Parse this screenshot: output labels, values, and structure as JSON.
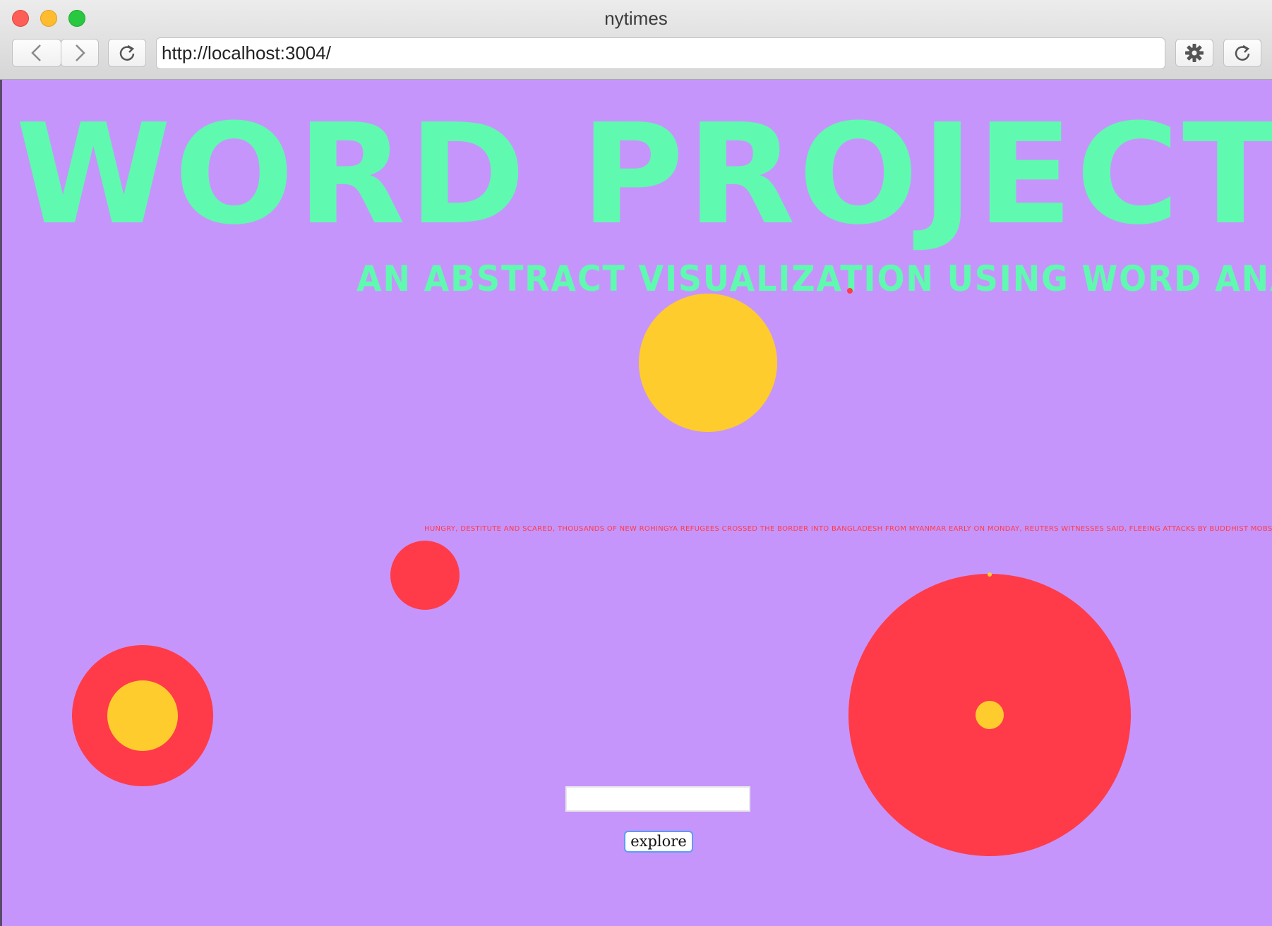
{
  "browser": {
    "window_title": "nytimes",
    "url": "http://localhost:3004/",
    "icons": [
      "back-arrow-icon",
      "forward-arrow-icon",
      "reload-icon",
      "gear-icon",
      "refresh-icon"
    ]
  },
  "page": {
    "headline": "WORD PROJECT",
    "subtitle": "AN ABSTRACT VISUALIZATION USING WORD ANALYZATION",
    "ticker_text": "HUNGRY, DESTITUTE AND SCARED, THOUSANDS OF NEW ROHINGYA REFUGEES CROSSED THE BORDER INTO BANGLADESH FROM MYANMAR EARLY ON MONDAY, REUTERS WITNESSES SAID, FLEEING ATTACKS BY BUDDHIST MOBS AND HUNGER THAT THE UNITED NATIONS HA",
    "search_value": "",
    "explore_label": "explore"
  },
  "colors": {
    "background": "#c695fb",
    "accent_green": "#60f9b0",
    "red": "#ff3b4a",
    "yellow": "#ffcc2e"
  }
}
